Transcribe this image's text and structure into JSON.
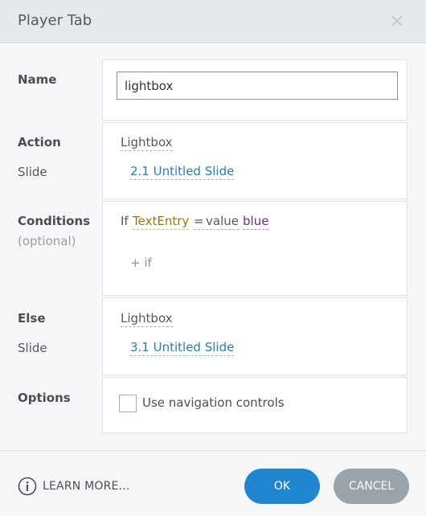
{
  "dialog": {
    "title": "Player Tab",
    "close_icon": "close-icon"
  },
  "name_row": {
    "label": "Name",
    "input_value": "lightbox"
  },
  "action_row": {
    "label": "Action",
    "sublabel": "Slide",
    "action_value": "Lightbox",
    "slide_value": "2.1 Untitled Slide"
  },
  "conditions_row": {
    "label": "Conditions",
    "hint": "(optional)",
    "if_word": "If",
    "variable": "TextEntry",
    "operator": "=",
    "value_word": "value",
    "value": "blue",
    "add_if": "+ if"
  },
  "else_row": {
    "label": "Else",
    "sublabel": "Slide",
    "action_value": "Lightbox",
    "slide_value": "3.1 Untitled Slide"
  },
  "options_row": {
    "label": "Options",
    "checkbox_label": "Use navigation controls",
    "checked": false
  },
  "footer": {
    "learn_more": "LEARN MORE...",
    "ok": "OK",
    "cancel": "CANCEL",
    "info_icon": "info-icon"
  },
  "colors": {
    "header_bg": "#e6e9ec",
    "body_bg": "#f5f6f7",
    "ok_button": "#2185d0",
    "cancel_button": "#9ba3aa",
    "link_blue": "#2b7fb0",
    "variable_color": "#8a7a10",
    "value_color": "#6b2f6f"
  }
}
